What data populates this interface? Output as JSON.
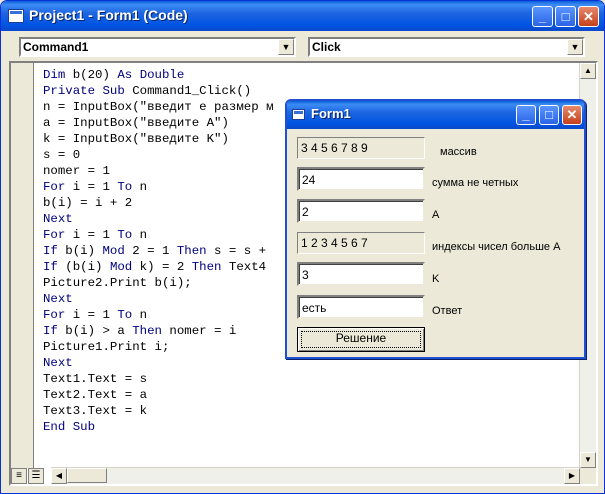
{
  "window": {
    "title": "Project1 - Form1 (Code)"
  },
  "object_combo": {
    "value": "Command1"
  },
  "procedure_combo": {
    "value": "Click"
  },
  "code": [
    "Dim b(20) As Double",
    "Private Sub Command1_Click()",
    "n = InputBox(\"введит е размер м",
    "a = InputBox(\"введите A\")",
    "k = InputBox(\"введите K\")",
    "s = 0",
    "nomer = 1",
    "For i = 1 To n",
    "b(i) = i + 2",
    "Next",
    "For i = 1 To n",
    "If b(i) Mod 2 = 1 Then s = s +",
    "If (b(i) Mod k) = 2 Then Text4",
    "Picture2.Print b(i);",
    "Next",
    "For i = 1 To n",
    "If b(i) > a Then nomer = i",
    "Picture1.Print i;",
    "Next",
    "Text1.Text = s",
    "Text2.Text = a",
    "Text3.Text = k",
    "End Sub"
  ],
  "form": {
    "title": "Form1",
    "picture2": "3 4 5 6 7 8 9",
    "label_array": "массив",
    "text1": "24",
    "label_sum": "сумма не четных",
    "text2": "2",
    "label_a": "A",
    "picture1": "1 2 3 4 5 6 7",
    "label_indexes": "индексы чисел больше А",
    "text3": "3",
    "label_k": "K",
    "text4": "есть",
    "label_answer": "Ответ",
    "button": "Решение"
  }
}
